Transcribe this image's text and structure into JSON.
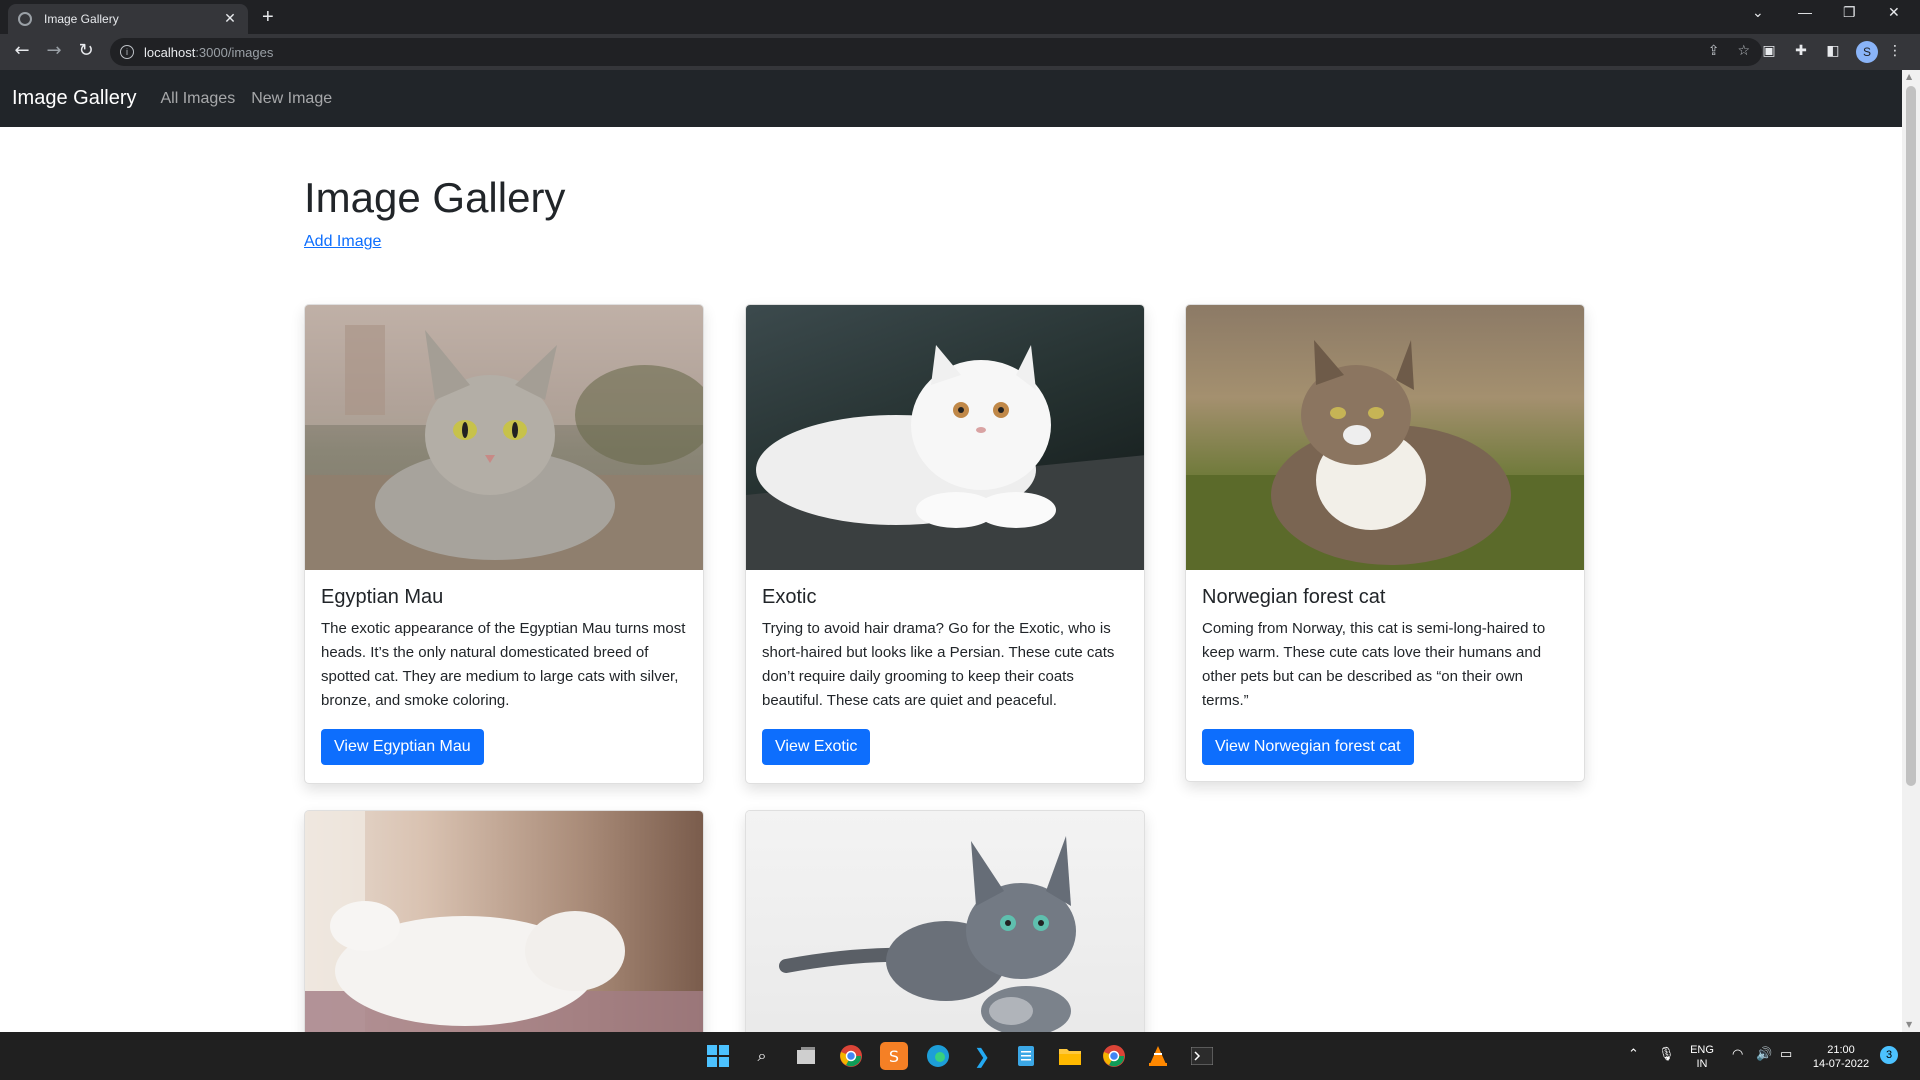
{
  "browser": {
    "tab_title": "Image Gallery",
    "url_host": "localhost",
    "url_path": ":3000/images",
    "profile_initial": "S"
  },
  "navbar": {
    "brand": "Image Gallery",
    "links": [
      "All Images",
      "New Image"
    ]
  },
  "main": {
    "title": "Image Gallery",
    "add_link": "Add Image"
  },
  "cards": [
    {
      "title": "Egyptian Mau",
      "text": "The exotic appearance of the Egyptian Mau turns most heads. It’s the only natural domesticated breed of spotted cat. They are medium to large cats with silver, bronze, and smoke coloring.",
      "button": "View Egyptian Mau"
    },
    {
      "title": "Exotic",
      "text": "Trying to avoid hair drama? Go for the Exotic, who is short-haired but looks like a Persian. These cute cats don’t require daily grooming to keep their coats beautiful. These cats are quiet and peaceful.",
      "button": "View Exotic"
    },
    {
      "title": "Norwegian forest cat",
      "text": "Coming from Norway, this cat is semi-long-haired to keep warm. These cute cats love their humans and other pets but can be described as “on their own terms.”",
      "button": "View Norwegian forest cat"
    }
  ],
  "taskbar": {
    "language_top": "ENG",
    "language_bottom": "IN",
    "time": "21:00",
    "date": "14-07-2022",
    "notification_count": "3"
  },
  "colors": {
    "primary": "#0d6efd",
    "navbar_bg": "#212529"
  }
}
